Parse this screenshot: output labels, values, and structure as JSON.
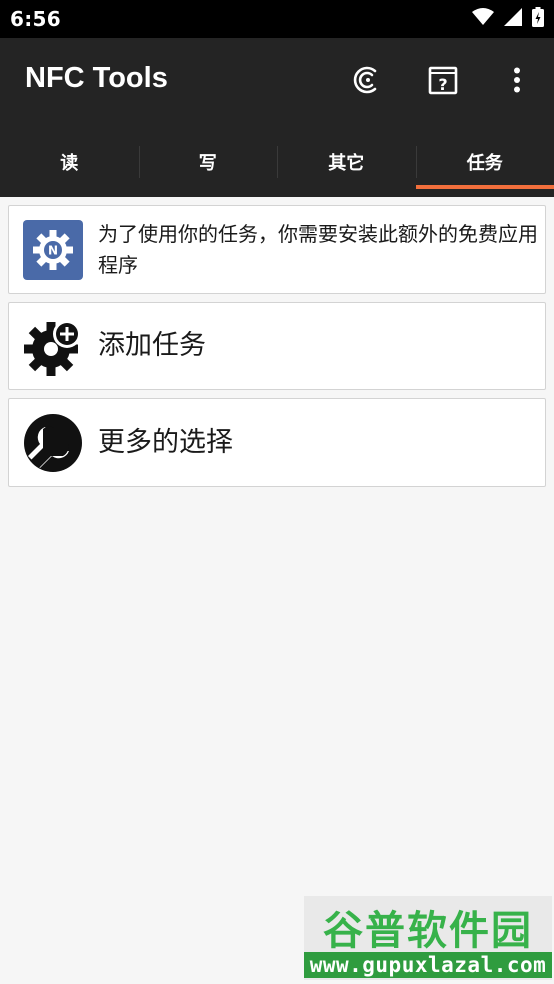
{
  "status_bar": {
    "time": "6:56",
    "icons": [
      "wifi-icon",
      "signal-icon",
      "battery-icon"
    ]
  },
  "app_bar": {
    "title": "NFC Tools",
    "actions": [
      "nfc-scan-icon",
      "help-book-icon",
      "more-vert-icon"
    ]
  },
  "tabs": [
    {
      "label": "读",
      "active": false
    },
    {
      "label": "写",
      "active": false
    },
    {
      "label": "其它",
      "active": false
    },
    {
      "label": "任务",
      "active": true
    }
  ],
  "cards": [
    {
      "text": "为了使用你的任务，你需要安装此额外的免费应用程序",
      "icon": "nfc-tasks-app-icon"
    },
    {
      "text": "添加任务",
      "icon": "gear-add-icon"
    },
    {
      "text": "更多的选择",
      "icon": "wrench-icon"
    }
  ],
  "watermark": {
    "title": "谷普软件园",
    "url": "www.gupuxlazal.com"
  },
  "colors": {
    "app_bar": "#242424",
    "tab_indicator": "#f26f3c",
    "background": "#f6f6f6",
    "task_icon_blue": "#4a6aa8"
  }
}
